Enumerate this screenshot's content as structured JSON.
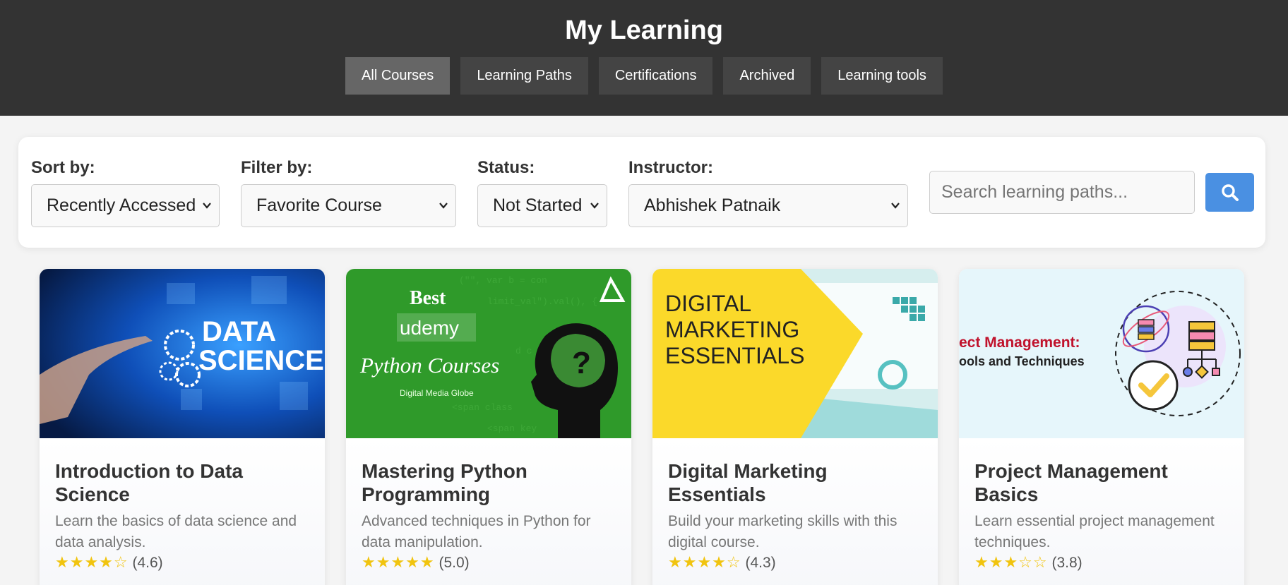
{
  "header": {
    "title": "My Learning",
    "tabs": [
      {
        "label": "All Courses",
        "active": true
      },
      {
        "label": "Learning Paths",
        "active": false
      },
      {
        "label": "Certifications",
        "active": false
      },
      {
        "label": "Archived",
        "active": false
      },
      {
        "label": "Learning tools",
        "active": false
      }
    ]
  },
  "filters": {
    "sort": {
      "label": "Sort by:",
      "value": "Recently Accessed"
    },
    "filter": {
      "label": "Filter by:",
      "value": "Favorite Course"
    },
    "status": {
      "label": "Status:",
      "value": "Not Started"
    },
    "instructor": {
      "label": "Instructor:",
      "value": "Abhishek Patnaik"
    },
    "search": {
      "placeholder": "Search learning paths...",
      "icon": "search-icon"
    }
  },
  "colors": {
    "header_bg": "#333333",
    "tab_active": "#666666",
    "tab_bg": "#444444",
    "search_button": "#4a90e2",
    "star": "#f1c40f"
  },
  "thumbnails": {
    "data_science": {
      "line1": "DATA",
      "line2": "SCIENCE"
    },
    "python": {
      "line1": "Best",
      "line2": "udemy",
      "line3": "Python Courses",
      "line4": "Digital Media Globe"
    },
    "marketing": {
      "line1": "DIGITAL",
      "line2": "MARKETING",
      "line3": "ESSENTIALS"
    },
    "project": {
      "line1": "ect Management:",
      "line2": "ools and Techniques"
    }
  },
  "courses": [
    {
      "title": "Introduction to Data Science",
      "description": "Learn the basics of data science and data analysis.",
      "stars": "★★★★☆",
      "rating": "(4.6)"
    },
    {
      "title": "Mastering Python Programming",
      "description": "Advanced techniques in Python for data manipulation.",
      "stars": "★★★★★",
      "rating": "(5.0)"
    },
    {
      "title": "Digital Marketing Essentials",
      "description": "Build your marketing skills with this digital course.",
      "stars": "★★★★☆",
      "rating": "(4.3)"
    },
    {
      "title": "Project Management Basics",
      "description": "Learn essential project management techniques.",
      "stars": "★★★☆☆",
      "rating": "(3.8)"
    }
  ]
}
